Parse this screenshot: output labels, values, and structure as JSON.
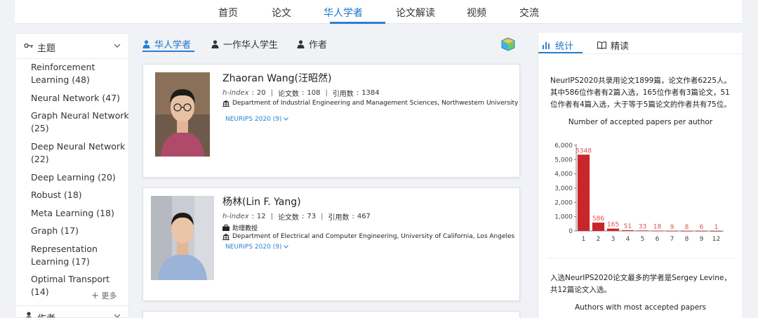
{
  "nav": {
    "items": [
      "首页",
      "论文",
      "华人学者",
      "论文解读",
      "视频",
      "交流"
    ],
    "active_index": 2
  },
  "sidebar": {
    "section_title": "主题",
    "topics": [
      "Reinforcement Learning (48)",
      "Neural Network (47)",
      "Graph Neural Network (25)",
      "Deep Neural Network (22)",
      "Deep Learning (20)",
      "Robust (18)",
      "Meta Learning (18)",
      "Graph (17)",
      "Representation Learning (17)",
      "Optimal Transport (14)"
    ],
    "more_label": "更多",
    "section2_title": "作者"
  },
  "tabs": [
    "华人学者",
    "一作华人学生",
    "作者"
  ],
  "scholars": [
    {
      "name": "Zhaoran Wang(汪昭然)",
      "hindex_label": "h-index",
      "hindex": "20",
      "papers_label": "论文数",
      "papers": "108",
      "citations_label": "引用数",
      "citations": "1384",
      "title": "",
      "affiliation": "Department of Industrial Engineering and Management Sciences, Northwestern University",
      "venue": "NEURIPS 2020 (9)"
    },
    {
      "name": "杨林(Lin F. Yang)",
      "hindex_label": "h-index",
      "hindex": "12",
      "papers_label": "论文数",
      "papers": "73",
      "citations_label": "引用数",
      "citations": "467",
      "title": "助理教授",
      "affiliation": "Department of Electrical and Computer Engineering, University of California, Los Angeles",
      "venue": "NEURIPS 2020 (9)"
    }
  ],
  "right_panel": {
    "tabs": [
      "统计",
      "精读"
    ],
    "summary": "NeurIPS2020共录用论文1899篇，论文作者6225人。其中586位作者有2篇入选，165位作者有3篇论文，51位作者有4篇入选，大于等于5篇论文的作者共有75位。",
    "chart_title": "Number of accepted papers per author",
    "top_text": "入选NeurIPS2020论文最多的学者是Sergey Levine，共12篇论文入选。",
    "chart2_title": "Authors with most accepted papers"
  },
  "colors": {
    "accent": "#2a7fd4",
    "bar": "#c8262b",
    "bar_label": "#d9534f"
  },
  "chart_data": {
    "type": "bar",
    "title": "Number of accepted papers per author",
    "categories": [
      "1",
      "2",
      "3",
      "4",
      "5",
      "6",
      "7",
      "8",
      "9",
      "12"
    ],
    "values": [
      5348,
      586,
      165,
      51,
      33,
      18,
      9,
      8,
      6,
      1
    ],
    "yticks": [
      0,
      1000,
      2000,
      3000,
      4000,
      5000,
      6000
    ],
    "ytick_labels": [
      "0",
      "1,000",
      "2,000",
      "3,000",
      "4,000",
      "5,000",
      "6,000"
    ],
    "ylim": [
      0,
      6000
    ],
    "xlabel": "",
    "ylabel": ""
  }
}
